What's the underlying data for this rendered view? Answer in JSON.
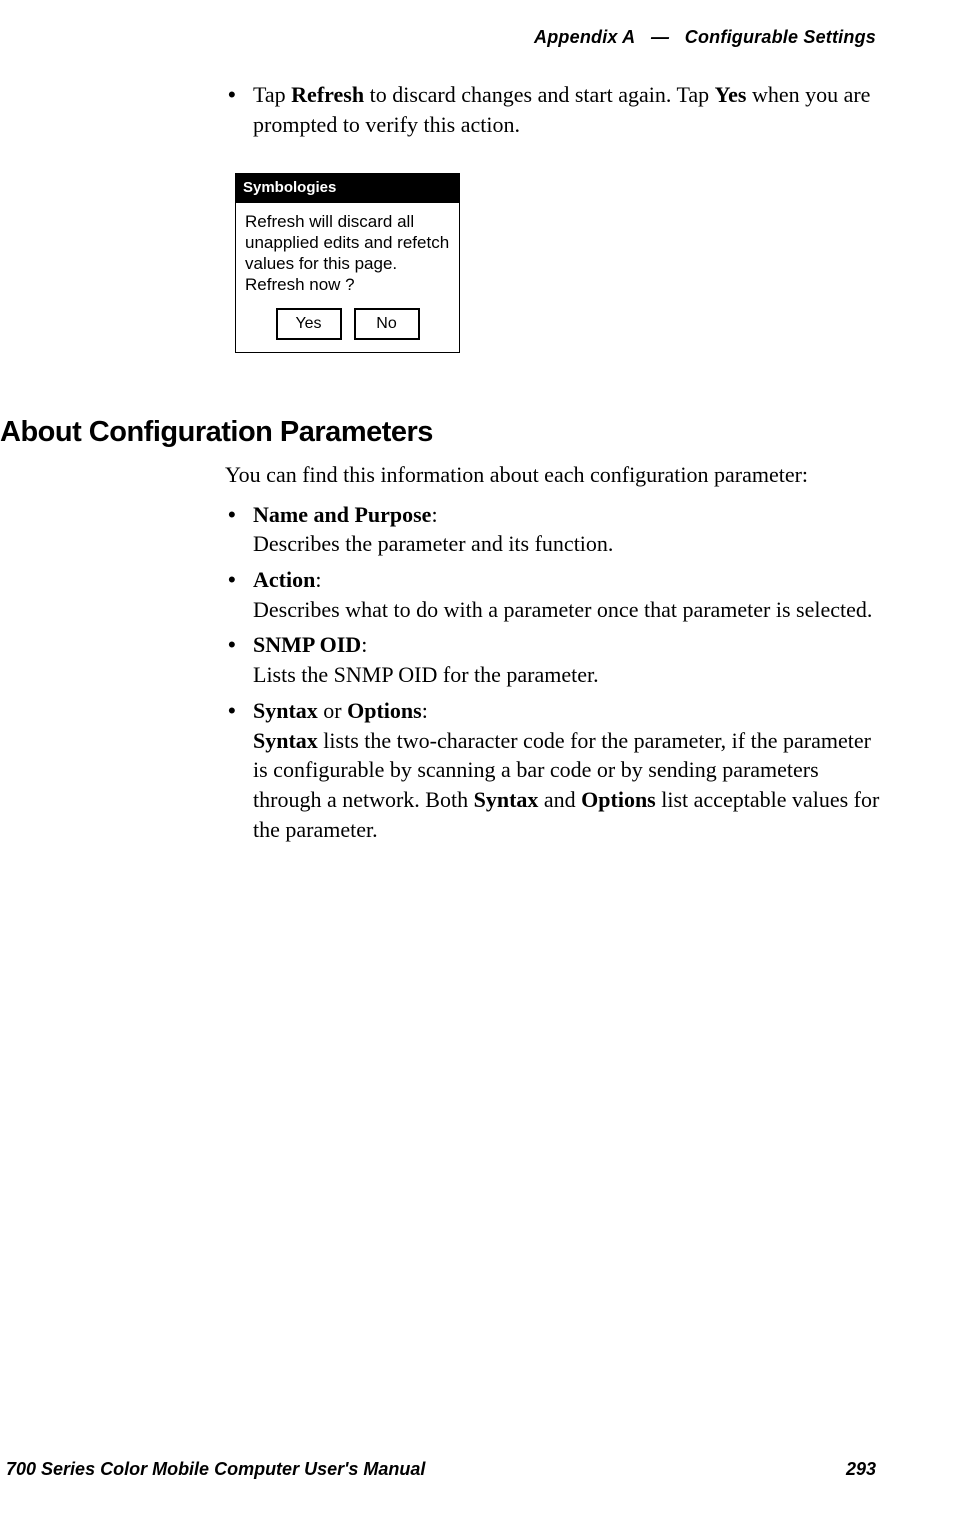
{
  "header": {
    "appendix": "Appendix A",
    "sep": "—",
    "title": "Configurable Settings"
  },
  "bullet1": {
    "pre": "Tap ",
    "bold1": "Refresh",
    "mid": " to discard changes and start again. Tap ",
    "bold2": "Yes",
    "post": " when you are prompted to verify this action."
  },
  "dialog": {
    "title": "Symbologies",
    "body": "Refresh will discard all unapplied edits and refetch values for this page. Refresh now ?",
    "yes": "Yes",
    "no": "No"
  },
  "section": {
    "heading": "About Configuration Parameters",
    "intro": "You can find this information about each configuration parameter:"
  },
  "params": [
    {
      "label": "Name and Purpose",
      "colon": ":",
      "desc": "Describes the parameter and its function."
    },
    {
      "label": "Action",
      "colon": ":",
      "desc": "Describes what to do with a parameter once that parameter is selected."
    },
    {
      "label": "SNMP OID",
      "colon": ":",
      "desc": "Lists the SNMP OID for the parameter."
    }
  ],
  "syntax_item": {
    "bold1": "Syntax",
    "or": " or ",
    "bold2": "Options",
    "colon": ":",
    "line1a": "Syntax",
    "line1b": " lists the two-character code for the parameter, if the parameter is configurable by scanning a bar code or by sending parameters through a network. Both ",
    "line1c": "Syntax",
    "line1d": " and ",
    "line1e": "Options",
    "line1f": " list acceptable values for the parameter."
  },
  "footer": {
    "left": "700 Series Color Mobile Computer User's Manual",
    "right": "293"
  }
}
